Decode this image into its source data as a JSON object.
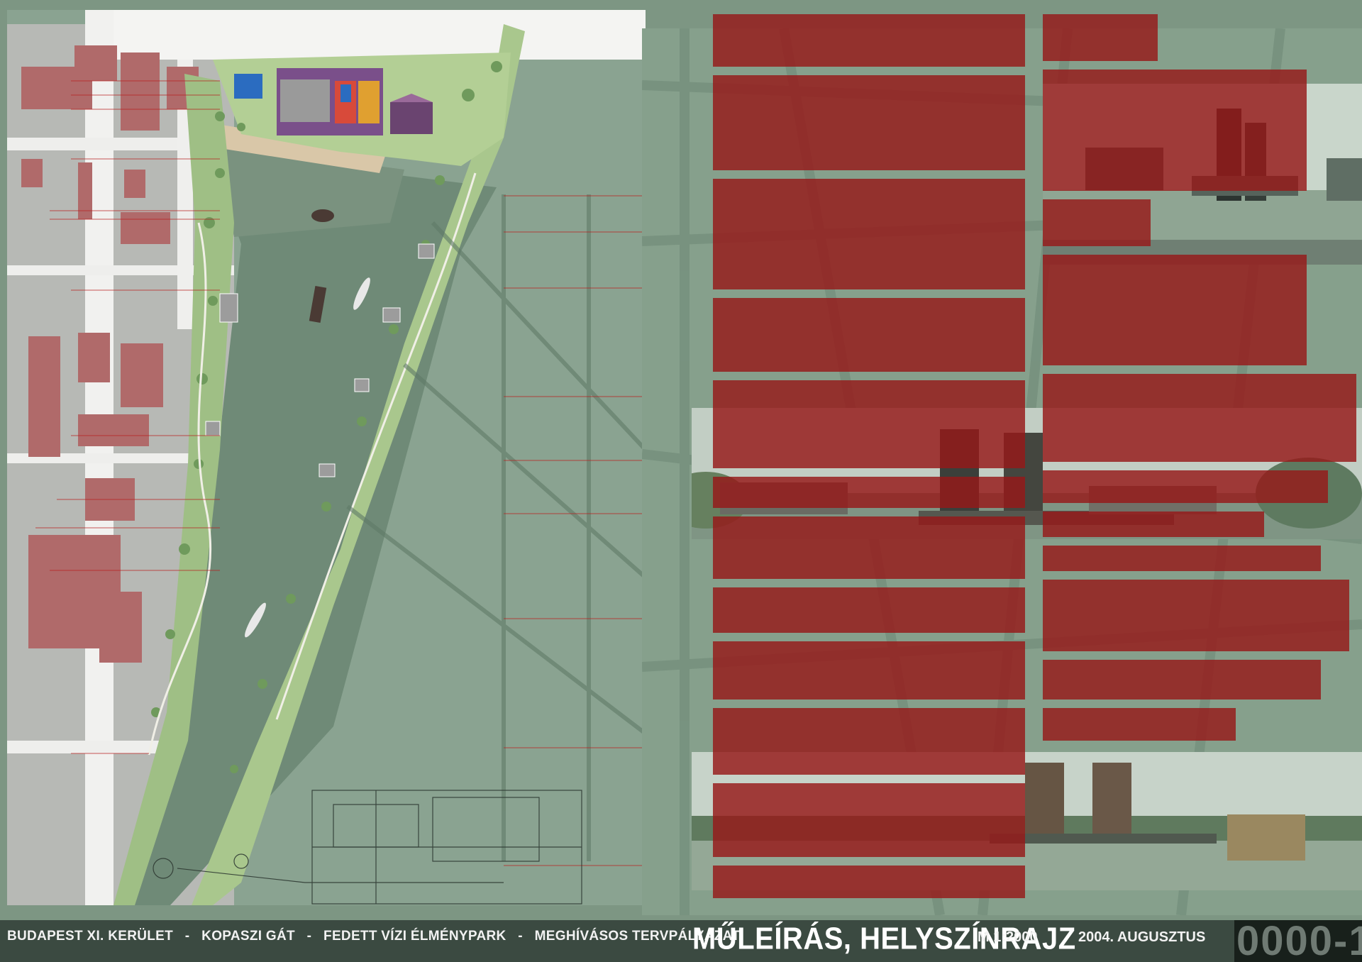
{
  "footer": {
    "location": "BUDAPEST XI. KERÜLET",
    "site": "KOPASZI GÁT",
    "project": "FEDETT VÍZI ÉLMÉNYPARK",
    "competition": "MEGHÍVÁSOS TERVPÁLYÁZAT",
    "sheet_title": "MŰLEÍRÁS, HELYSZÍNRAJZ",
    "scale": "M 1:2000",
    "date": "2004. AUGUSZTUS",
    "sheet_code": "0000-1"
  },
  "separator": "-",
  "colors": {
    "background": "#7d9683",
    "text_red": "#a11414",
    "footer": "#3b4a41"
  }
}
